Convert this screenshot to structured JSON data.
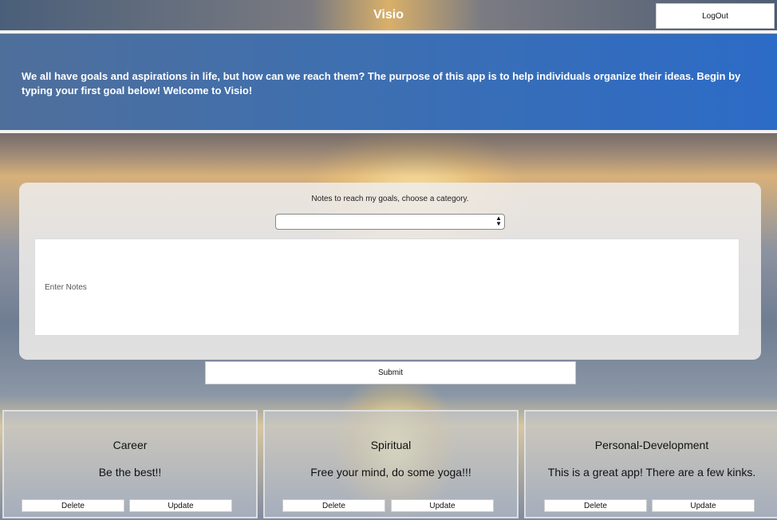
{
  "header": {
    "title": "Visio",
    "logout_label": "LogOut"
  },
  "intro": {
    "text": "We all have goals and aspirations in life, but how can we reach them? The purpose of this app is to help individuals organize their ideas. Begin by typing your first goal below! Welcome to Visio!"
  },
  "form": {
    "label": "Notes to reach my goals, choose a category.",
    "category_selected": "",
    "notes_placeholder": "Enter Notes",
    "submit_label": "Submit"
  },
  "cards": [
    {
      "category": "Career",
      "note": "Be the best!!",
      "delete_label": "Delete",
      "update_label": "Update"
    },
    {
      "category": "Spiritual",
      "note": "Free your mind, do some yoga!!!",
      "delete_label": "Delete",
      "update_label": "Update"
    },
    {
      "category": "Personal-Development",
      "note": "This is a great app! There are a few kinks.",
      "delete_label": "Delete",
      "update_label": "Update"
    }
  ],
  "colors": {
    "intro_band": "#2c6bc7",
    "button_bg": "#ffffff"
  }
}
